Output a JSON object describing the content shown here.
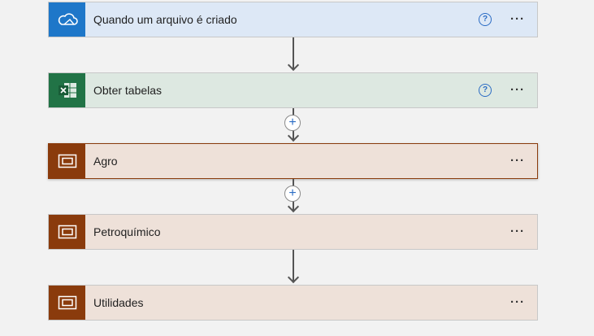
{
  "steps": [
    {
      "title": "Quando um arquivo é criado",
      "icon": "onedrive-cloud-icon",
      "help": "?",
      "more": "···"
    },
    {
      "title": "Obter tabelas",
      "icon": "excel-icon",
      "help": "?",
      "more": "···"
    },
    {
      "title": "Agro",
      "icon": "scope-icon",
      "more": "···"
    },
    {
      "title": "Petroquímico",
      "icon": "scope-icon",
      "more": "···"
    },
    {
      "title": "Utilidades",
      "icon": "scope-icon",
      "more": "···"
    }
  ],
  "insert_step_symbol": "+",
  "colors": {
    "onedrive_header": "#1e77c9",
    "onedrive_card": "#dde8f6",
    "excel_header": "#217346",
    "excel_card": "#dde8e1",
    "scope_header": "#8a3b0c",
    "scope_card": "#eee1d9",
    "help_blue": "#2b6cc4"
  }
}
